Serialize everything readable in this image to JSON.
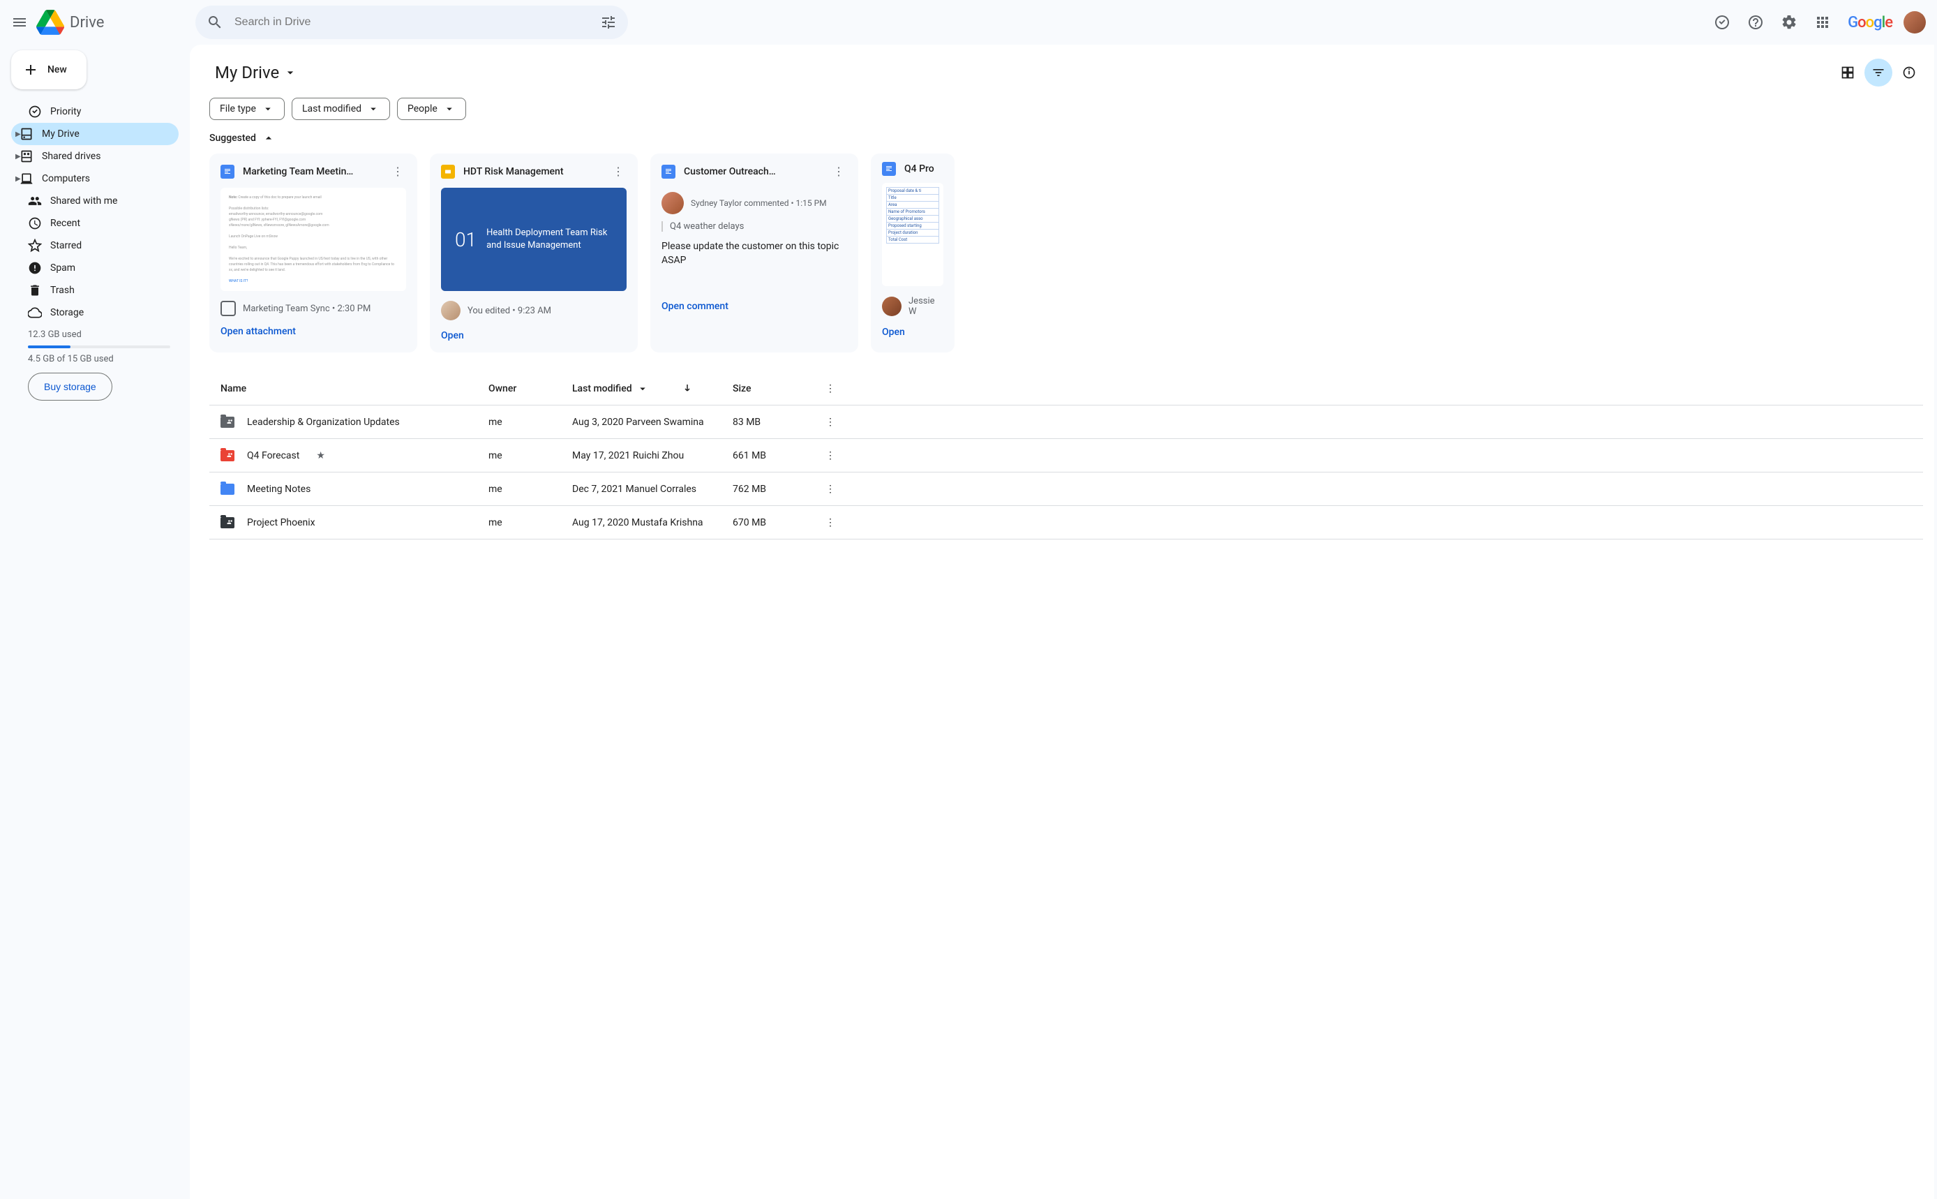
{
  "app": {
    "name": "Drive",
    "search_placeholder": "Search in Drive"
  },
  "sidebar": {
    "new_label": "New",
    "items": [
      {
        "label": "Priority"
      },
      {
        "label": "My Drive"
      },
      {
        "label": "Shared drives"
      },
      {
        "label": "Computers"
      },
      {
        "label": "Shared with me"
      },
      {
        "label": "Recent"
      },
      {
        "label": "Starred"
      },
      {
        "label": "Spam"
      },
      {
        "label": "Trash"
      },
      {
        "label": "Storage"
      }
    ],
    "storage_used_short": "12.3 GB used",
    "storage_used_long": "4.5 GB of 15 GB used",
    "buy_label": "Buy storage"
  },
  "breadcrumb": {
    "title": "My Drive"
  },
  "chips": [
    {
      "label": "File type"
    },
    {
      "label": "Last modified"
    },
    {
      "label": "People"
    }
  ],
  "suggested_label": "Suggested",
  "cards": [
    {
      "type": "docs",
      "title": "Marketing Team Meetin…",
      "footer": "Marketing Team Sync • 2:30 PM",
      "action": "Open attachment"
    },
    {
      "type": "slides",
      "title": "HDT Risk Management",
      "slide_num": "01",
      "slide_text": "Health Deployment Team Risk and Issue Management",
      "footer": "You edited • 9:23 AM",
      "action": "Open"
    },
    {
      "type": "docs",
      "title": "Customer Outreach…",
      "comment_author": "Sydney Taylor commented • 1:15 PM",
      "quote": "Q4 weather delays",
      "comment": "Please update the customer on this topic ASAP",
      "action": "Open comment"
    },
    {
      "type": "docs",
      "title": "Q4 Pro",
      "footer_author": "Jessie W",
      "action": "Open"
    }
  ],
  "table": {
    "headers": {
      "name": "Name",
      "owner": "Owner",
      "modified": "Last modified",
      "size": "Size"
    },
    "rows": [
      {
        "icon": "gray",
        "shared": true,
        "name": "Leadership & Organization Updates",
        "owner": "me",
        "modified": "Aug 3, 2020 Parveen Swamina",
        "size": "83 MB"
      },
      {
        "icon": "red",
        "shared": true,
        "starred": true,
        "name": "Q4 Forecast",
        "owner": "me",
        "modified": "May 17, 2021 Ruichi Zhou",
        "size": "661 MB"
      },
      {
        "icon": "blue",
        "name": "Meeting Notes",
        "owner": "me",
        "modified": "Dec 7, 2021 Manuel Corrales",
        "size": "762 MB"
      },
      {
        "icon": "dark",
        "shared": true,
        "name": "Project Phoenix",
        "owner": "me",
        "modified": "Aug 17, 2020 Mustafa Krishna",
        "size": "670 MB"
      }
    ]
  },
  "table_preview_lines": [
    "Proposal date & ti",
    "Title",
    "Area",
    "Name of Promotors",
    "Geographical asso",
    "Proposed starting",
    "Project duration",
    "Total Cost"
  ]
}
